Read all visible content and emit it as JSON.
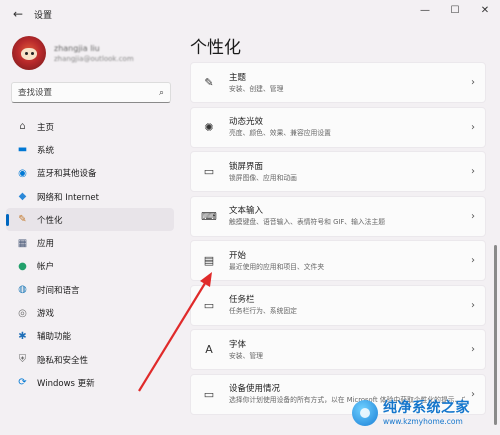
{
  "window": {
    "back_icon": "back-arrow-icon",
    "title": "设置",
    "controls": [
      "—",
      "☐",
      "✕"
    ]
  },
  "profile": {
    "name": "zhangjia liu",
    "email": "zhangjia@outlook.com"
  },
  "search": {
    "placeholder": "查找设置"
  },
  "sidebar": {
    "items": [
      {
        "label": "主页",
        "icon": "home-icon",
        "glyph": "⌂",
        "color": "#555555"
      },
      {
        "label": "系统",
        "icon": "monitor-icon",
        "glyph": "▬",
        "color": "#0078d4"
      },
      {
        "label": "蓝牙和其他设备",
        "icon": "bluetooth-devices-icon",
        "glyph": "◉",
        "color": "#0078d4"
      },
      {
        "label": "网络和 Internet",
        "icon": "wifi-icon",
        "glyph": "◆",
        "color": "#2b88d8"
      },
      {
        "label": "个性化",
        "icon": "paintbrush-icon",
        "glyph": "✎",
        "color": "#c47a2c"
      },
      {
        "label": "应用",
        "icon": "apps-icon",
        "glyph": "▦",
        "color": "#4a5a78"
      },
      {
        "label": "帐户",
        "icon": "account-icon",
        "glyph": "●",
        "color": "#22a06b"
      },
      {
        "label": "时间和语言",
        "icon": "globe-clock-icon",
        "glyph": "◍",
        "color": "#1f7ab8"
      },
      {
        "label": "游戏",
        "icon": "gamepad-icon",
        "glyph": "◎",
        "color": "#6b6b6b"
      },
      {
        "label": "辅助功能",
        "icon": "accessibility-icon",
        "glyph": "✱",
        "color": "#1f6fb8"
      },
      {
        "label": "隐私和安全性",
        "icon": "shield-icon",
        "glyph": "⛨",
        "color": "#6b6b6b"
      },
      {
        "label": "Windows 更新",
        "icon": "windows-update-icon",
        "glyph": "⟳",
        "color": "#0078d4"
      }
    ],
    "active_index": 4
  },
  "main": {
    "title": "个性化",
    "cards": [
      {
        "title": "主题",
        "desc": "安装、创建、管理",
        "icon": "theme-brush-icon",
        "glyph": "✎"
      },
      {
        "title": "动态光效",
        "desc": "亮度、颜色、效果、兼容应用设置",
        "icon": "dynamic-lighting-icon",
        "glyph": "✺"
      },
      {
        "title": "锁屏界面",
        "desc": "锁屏图像、应用和动画",
        "icon": "lock-screen-icon",
        "glyph": "▭"
      },
      {
        "title": "文本输入",
        "desc": "触摸键盘、语音输入、表情符号和 GIF、输入法主题",
        "icon": "keyboard-icon",
        "glyph": "⌨"
      },
      {
        "title": "开始",
        "desc": "最近使用的应用和项目、文件夹",
        "icon": "start-menu-icon",
        "glyph": "▤"
      },
      {
        "title": "任务栏",
        "desc": "任务栏行为、系统固定",
        "icon": "taskbar-icon",
        "glyph": "▭"
      },
      {
        "title": "字体",
        "desc": "安装、管理",
        "icon": "fonts-icon",
        "glyph": "A"
      },
      {
        "title": "设备使用情况",
        "desc": "选择你计划使用设备的所有方式，以在 Microsoft 体验中获取个性化的提示、广告和建议",
        "icon": "device-usage-icon",
        "glyph": "▭"
      }
    ]
  },
  "watermark": {
    "title": "纯净系统之家",
    "url": "www.kzmyhome.com"
  },
  "colors": {
    "accent": "#0067c0",
    "arrow": "#e02a2a",
    "background": "#f3f0f3",
    "card": "#fbfbfb"
  }
}
